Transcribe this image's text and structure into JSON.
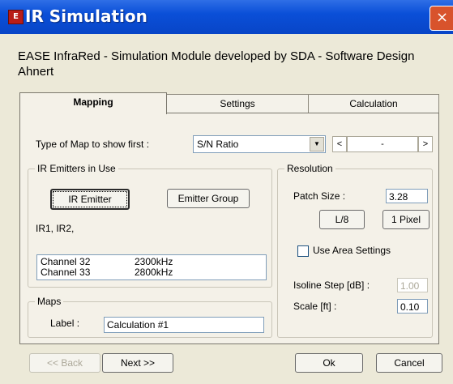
{
  "window": {
    "title": "IR Simulation",
    "app_icon": "ease-logo-icon",
    "close_glyph": "×"
  },
  "description": "EASE InfraRed - Simulation Module developed by SDA - Software Design Ahnert",
  "tabs": [
    {
      "label": "Mapping",
      "active": true
    },
    {
      "label": "Settings",
      "active": false
    },
    {
      "label": "Calculation",
      "active": false
    }
  ],
  "map_type": {
    "label": "Type of Map to show first :",
    "value": "S/N Ratio",
    "spin_value": "-",
    "spin_left": "<",
    "spin_right": ">"
  },
  "emitters": {
    "group_title": "IR Emitters in Use",
    "ir_emitter_button": "IR Emitter",
    "emitter_group_button": "Emitter Group",
    "in_use_text": "IR1, IR2,",
    "channels": [
      {
        "name": "Channel 32",
        "freq": "2300kHz"
      },
      {
        "name": "Channel 33",
        "freq": "2800kHz"
      }
    ]
  },
  "maps": {
    "group_title": "Maps",
    "label_caption": "Label :",
    "label_value": "Calculation #1"
  },
  "resolution": {
    "group_title": "Resolution",
    "patch_size_label": "Patch Size :",
    "patch_size_value": "3.28",
    "l8_button": "L/8",
    "pixel_button": "1 Pixel",
    "use_area_label": "Use Area Settings",
    "use_area_checked": false,
    "isoline_label": "Isoline Step [dB] :",
    "isoline_value": "1.00",
    "scale_label": "Scale [ft] :",
    "scale_value": "0.10"
  },
  "footer": {
    "back": "<< Back",
    "next": "Next >>",
    "ok": "Ok",
    "cancel": "Cancel"
  },
  "colors": {
    "titlebar": "#0A4FD8",
    "dialog_bg": "#ECE9D8",
    "panel_bg": "#F4F1E8",
    "close": "#D8532C"
  }
}
